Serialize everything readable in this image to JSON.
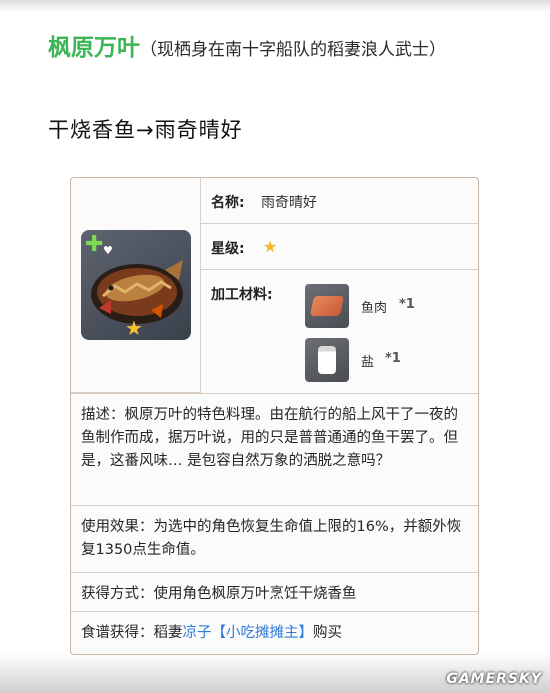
{
  "intro": {
    "character_name": "枫原万叶",
    "character_note": "（现栖身在南十字船队的稻妻浪人武士）",
    "dish_line": "干烧香鱼→雨奇晴好"
  },
  "card": {
    "name_label": "名称:",
    "name_value": "雨奇晴好",
    "rarity_label": "星级:",
    "rarity_stars": 1,
    "materials_label": "加工材料:",
    "materials": [
      {
        "name": "鱼肉",
        "qty": "*1",
        "icon": "fish-meat-icon"
      },
      {
        "name": "盐",
        "qty": "*1",
        "icon": "salt-icon"
      }
    ],
    "description": "描述：枫原万叶的特色料理。由在航行的船上风干了一夜的鱼制作而成，据万叶说，用的只是普普通通的鱼干罢了。但是，这番风味… 是包容自然万象的洒脱之意吗？",
    "effect": "使用效果：为选中的角色恢复生命值上限的16%，并额外恢复1350点生命值。",
    "obtain": "获得方式：使用角色枫原万叶烹饪干烧香鱼",
    "recipe_prefix": "食谱获得：稻妻",
    "recipe_link": "凉子【小吃摊摊主】",
    "recipe_suffix": "购买"
  },
  "watermark": "GAMERSKY",
  "colors": {
    "character_name": "#3cb554",
    "link": "#2f7bd8",
    "star": "#f2b624",
    "card_border": "#c7b6a7"
  }
}
